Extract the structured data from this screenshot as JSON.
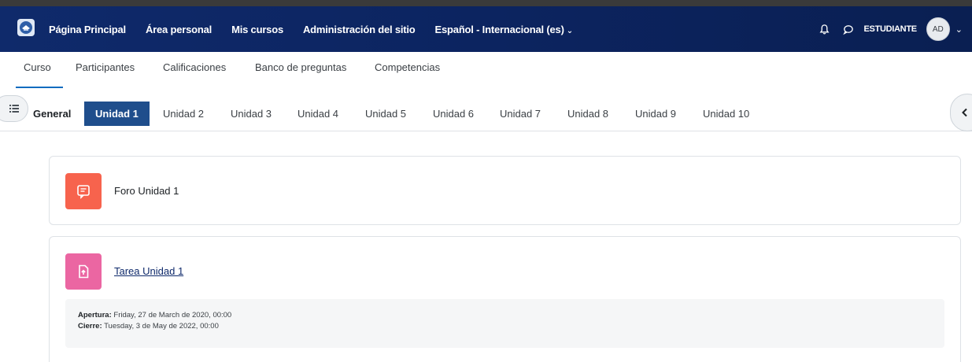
{
  "topbar": {
    "logo_icon": "school-logo-icon",
    "links": [
      {
        "label": "Página Principal"
      },
      {
        "label": "Área personal"
      },
      {
        "label": "Mis cursos"
      },
      {
        "label": "Administración del sitio"
      },
      {
        "label": "Español - Internacional (es)"
      }
    ],
    "language_caret": "⌄",
    "username": "ESTUDIANTE",
    "avatar_initials": "AD",
    "avatar_caret": "⌄",
    "background_color": "#0c2460"
  },
  "secondary_nav": {
    "items": [
      {
        "label": "Curso"
      },
      {
        "label": "Participantes"
      },
      {
        "label": "Calificaciones"
      },
      {
        "label": "Banco de preguntas"
      },
      {
        "label": "Competencias"
      }
    ],
    "active": "Curso"
  },
  "units": {
    "tabs": [
      {
        "label": "General"
      },
      {
        "label": "Unidad 1"
      },
      {
        "label": "Unidad 2"
      },
      {
        "label": "Unidad 3"
      },
      {
        "label": "Unidad 4"
      },
      {
        "label": "Unidad 5"
      },
      {
        "label": "Unidad 6"
      },
      {
        "label": "Unidad 7"
      },
      {
        "label": "Unidad 8"
      },
      {
        "label": "Unidad 9"
      },
      {
        "label": "Unidad 10"
      }
    ],
    "active": "Unidad 1",
    "active_color": "#1f4e8c"
  },
  "activities": [
    {
      "name": "Foro Unidad 1",
      "icon": "forum-icon",
      "icon_color": "#f7634d"
    },
    {
      "name": "Tarea Unidad 1",
      "icon": "assignment-icon",
      "icon_color": "#eb66a2",
      "dates": {
        "open_label": "Apertura:",
        "open_value": "Friday, 27 de March de 2020, 00:00",
        "close_label": "Cierre:",
        "close_value": "Tuesday, 3 de May de 2022, 00:00"
      }
    }
  ]
}
